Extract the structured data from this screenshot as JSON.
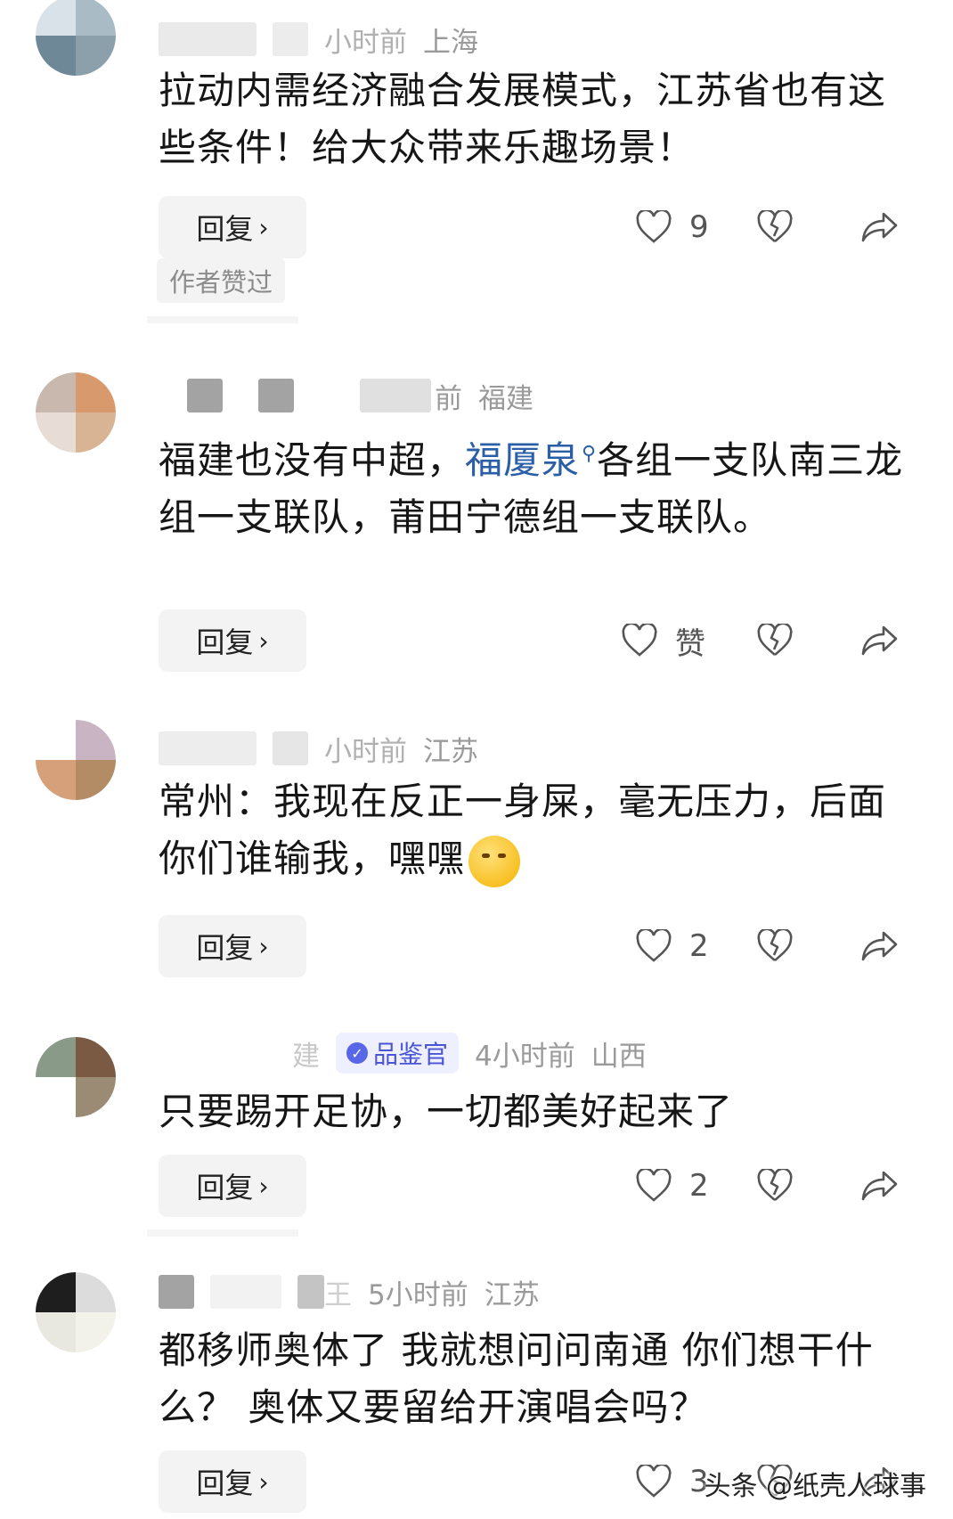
{
  "comments": [
    {
      "meta": {
        "time_partial": "小时前",
        "location": "上海"
      },
      "text": "拉动内需经济融合发展模式，江苏省也有这些条件！给大众带来乐趣场景！",
      "reply_label": "回复",
      "likes": "9",
      "author_tag": "作者赞过"
    },
    {
      "meta": {
        "time_partial": "前",
        "location": "福建"
      },
      "text_before": "福建也没有中超，",
      "link": "福厦泉",
      "text_after": "各组一支队南三龙组一支联队，莆田宁德组一支联队。",
      "reply_label": "回复",
      "likes": "赞"
    },
    {
      "meta": {
        "time_partial": "小时前",
        "location": "江苏"
      },
      "text": "常州：我现在反正一身屎，毫无压力，后面你们谁输我，嘿嘿",
      "reply_label": "回复",
      "likes": "2"
    },
    {
      "meta": {
        "name_partial": "建",
        "badge": "品鉴官",
        "time": "4小时前",
        "location": "山西"
      },
      "text": "只要踢开足协，一切都美好起来了",
      "reply_label": "回复",
      "likes": "2"
    },
    {
      "meta": {
        "name_partial": "王",
        "time": "5小时前",
        "location": "江苏"
      },
      "text": "都移师奥体了 我就想问问南通 你们想干什么？ 奥体又要留给开演唱会吗？",
      "reply_label": "回复",
      "likes": "3"
    }
  ],
  "watermark": "头条 @纸壳人球事",
  "colors": {
    "link": "#2a5fa8",
    "badge_bg": "#eef0ff",
    "badge_text": "#4a55d6",
    "button_bg": "#f3f3f3"
  }
}
